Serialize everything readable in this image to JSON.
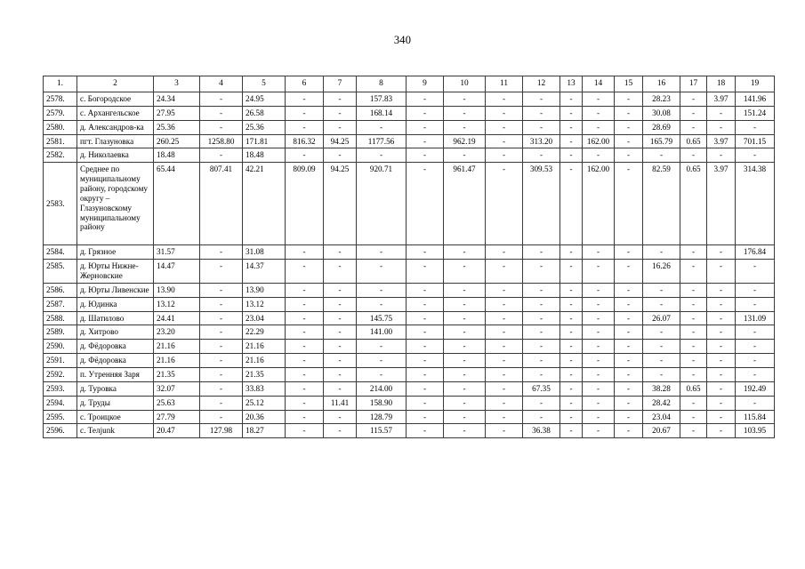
{
  "page": {
    "number": "340"
  },
  "table": {
    "columns": [
      "1.",
      "2",
      "3",
      "4",
      "5",
      "6",
      "7",
      "8",
      "9",
      "10",
      "11",
      "12",
      "13",
      "14",
      "15",
      "16",
      "17",
      "18",
      "19"
    ],
    "rows": [
      {
        "index": "2578.",
        "name": "с. Богородское",
        "values": [
          "24.34",
          "-",
          "24.95",
          "-",
          "-",
          "157.83",
          "-",
          "-",
          "-",
          "-",
          "-",
          "-",
          "-",
          "28.23",
          "-",
          "3.97",
          "141.96"
        ]
      },
      {
        "index": "2579.",
        "name": "с. Архангельское",
        "values": [
          "27.95",
          "-",
          "26.58",
          "-",
          "-",
          "168.14",
          "-",
          "-",
          "-",
          "-",
          "-",
          "-",
          "-",
          "30.08",
          "-",
          "-",
          "151.24"
        ]
      },
      {
        "index": "2580.",
        "name": "д. Александров-ка",
        "values": [
          "25.36",
          "-",
          "25.36",
          "-",
          "-",
          "-",
          "-",
          "-",
          "-",
          "-",
          "-",
          "-",
          "-",
          "28.69",
          "-",
          "-",
          "-"
        ]
      },
      {
        "index": "2581.",
        "name": "пгт. Глазуновка",
        "values": [
          "260.25",
          "1258.80",
          "171.81",
          "816.32",
          "94.25",
          "1177.56",
          "-",
          "962.19",
          "-",
          "313.20",
          "-",
          "162.00",
          "-",
          "165.79",
          "0.65",
          "3.97",
          "701.15"
        ]
      },
      {
        "index": "2582.",
        "name": "д. Николаевка",
        "values": [
          "18.48",
          "-",
          "18.48",
          "-",
          "-",
          "-",
          "-",
          "-",
          "-",
          "-",
          "-",
          "-",
          "-",
          "-",
          "-",
          "-",
          "-"
        ]
      },
      {
        "index": "2583.",
        "name": "Среднее по муниципальному району, городскому округу – Глазуновскому муниципальному району",
        "tall": true,
        "values": [
          "65.44",
          "807.41",
          "42.21",
          "809.09",
          "94.25",
          "920.71",
          "-",
          "961.47",
          "-",
          "309.53",
          "-",
          "162.00",
          "-",
          "82.59",
          "0.65",
          "3.97",
          "314.38"
        ]
      },
      {
        "index": "2584.",
        "name": "д. Грязное",
        "values": [
          "31.57",
          "-",
          "31.08",
          "-",
          "-",
          "-",
          "-",
          "-",
          "-",
          "-",
          "-",
          "-",
          "-",
          "-",
          "-",
          "-",
          "176.84"
        ]
      },
      {
        "index": "2585.",
        "name": "д. Юрты Нижне-Жерновские",
        "values": [
          "14.47",
          "-",
          "14.37",
          "-",
          "-",
          "-",
          "-",
          "-",
          "-",
          "-",
          "-",
          "-",
          "-",
          "16.26",
          "-",
          "-",
          "-"
        ]
      },
      {
        "index": "2586.",
        "name": "д. Юрты Ливенские",
        "values": [
          "13.90",
          "-",
          "13.90",
          "-",
          "-",
          "-",
          "-",
          "-",
          "-",
          "-",
          "-",
          "-",
          "-",
          "-",
          "-",
          "-",
          "-"
        ]
      },
      {
        "index": "2587.",
        "name": "д. Юдинка",
        "values": [
          "13.12",
          "-",
          "13.12",
          "-",
          "-",
          "-",
          "-",
          "-",
          "-",
          "-",
          "-",
          "-",
          "-",
          "-",
          "-",
          "-",
          "-"
        ]
      },
      {
        "index": "2588.",
        "name": "д. Шатилово",
        "values": [
          "24.41",
          "-",
          "23.04",
          "-",
          "-",
          "145.75",
          "-",
          "-",
          "-",
          "-",
          "-",
          "-",
          "-",
          "26.07",
          "-",
          "-",
          "131.09"
        ]
      },
      {
        "index": "2589.",
        "name": "д. Хитрово",
        "values": [
          "23.20",
          "-",
          "22.29",
          "-",
          "-",
          "141.00",
          "-",
          "-",
          "-",
          "-",
          "-",
          "-",
          "-",
          "-",
          "-",
          "-",
          "-"
        ]
      },
      {
        "index": "2590.",
        "name": "д. Фёдоровка",
        "values": [
          "21.16",
          "-",
          "21.16",
          "-",
          "-",
          "-",
          "-",
          "-",
          "-",
          "-",
          "-",
          "-",
          "-",
          "-",
          "-",
          "-",
          "-"
        ]
      },
      {
        "index": "2591.",
        "name": "д. Фёдоровка",
        "values": [
          "21.16",
          "-",
          "21.16",
          "-",
          "-",
          "-",
          "-",
          "-",
          "-",
          "-",
          "-",
          "-",
          "-",
          "-",
          "-",
          "-",
          "-"
        ]
      },
      {
        "index": "2592.",
        "name": "п. Утренняя Заря",
        "values": [
          "21.35",
          "-",
          "21.35",
          "-",
          "-",
          "-",
          "-",
          "-",
          "-",
          "-",
          "-",
          "-",
          "-",
          "-",
          "-",
          "-",
          "-"
        ]
      },
      {
        "index": "2593.",
        "name": "д. Туровка",
        "values": [
          "32.07",
          "-",
          "33.83",
          "-",
          "-",
          "214.00",
          "-",
          "-",
          "-",
          "67.35",
          "-",
          "-",
          "-",
          "38.28",
          "0.65",
          "-",
          "192.49"
        ]
      },
      {
        "index": "2594.",
        "name": "д. Труды",
        "values": [
          "25.63",
          "-",
          "25.12",
          "-",
          "11.41",
          "158.90",
          "-",
          "-",
          "-",
          "-",
          "-",
          "-",
          "-",
          "28.42",
          "-",
          "-",
          "-"
        ]
      },
      {
        "index": "2595.",
        "name": "с. Троицкое",
        "values": [
          "27.79",
          "-",
          "20.36",
          "-",
          "-",
          "128.79",
          "-",
          "-",
          "-",
          "-",
          "-",
          "-",
          "-",
          "23.04",
          "-",
          "-",
          "115.84"
        ]
      },
      {
        "index": "2596.",
        "name": "с. Телjunk",
        "values": [
          "20.47",
          "127.98",
          "18.27",
          "-",
          "-",
          "115.57",
          "-",
          "-",
          "-",
          "36.38",
          "-",
          "-",
          "-",
          "20.67",
          "-",
          "-",
          "103.95"
        ]
      }
    ]
  }
}
